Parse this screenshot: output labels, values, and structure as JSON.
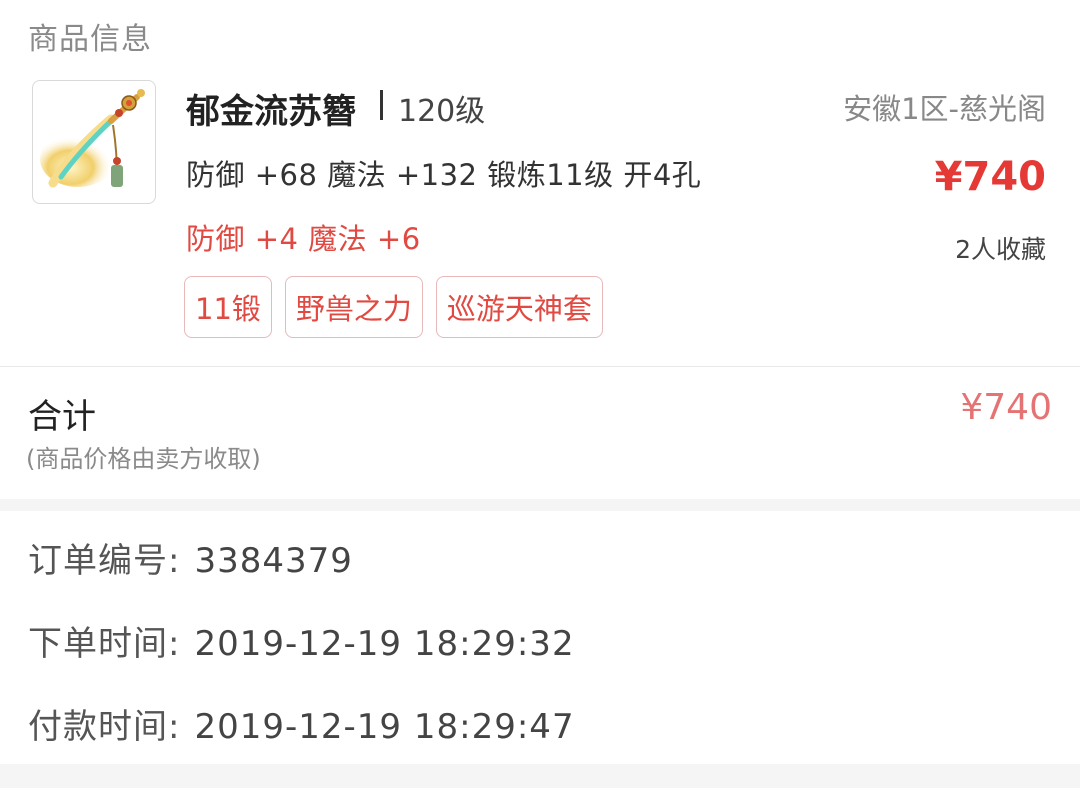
{
  "section_title": "商品信息",
  "item": {
    "name": "郁金流苏簪",
    "level": "120级",
    "server": "安徽1区-慈光阁",
    "stats": "防御 +68 魔法 +132 锻炼11级 开4孔",
    "bonus": "防御 +4 魔法 +6",
    "price": "¥740",
    "favorites": "2人收藏",
    "tags": [
      "11锻",
      "野兽之力",
      "巡游天神套"
    ]
  },
  "total": {
    "label": "合计",
    "note": "(商品价格由卖方收取)",
    "price": "¥740"
  },
  "order": {
    "number_label": "订单编号:",
    "number_value": "3384379",
    "placed_label": "下单时间:",
    "placed_value": "2019-12-19 18:29:32",
    "paid_label": "付款时间:",
    "paid_value": "2019-12-19 18:29:47"
  },
  "colors": {
    "price_red": "#e53935",
    "tag_red": "#e04a42",
    "background": "#f5f5f5"
  }
}
